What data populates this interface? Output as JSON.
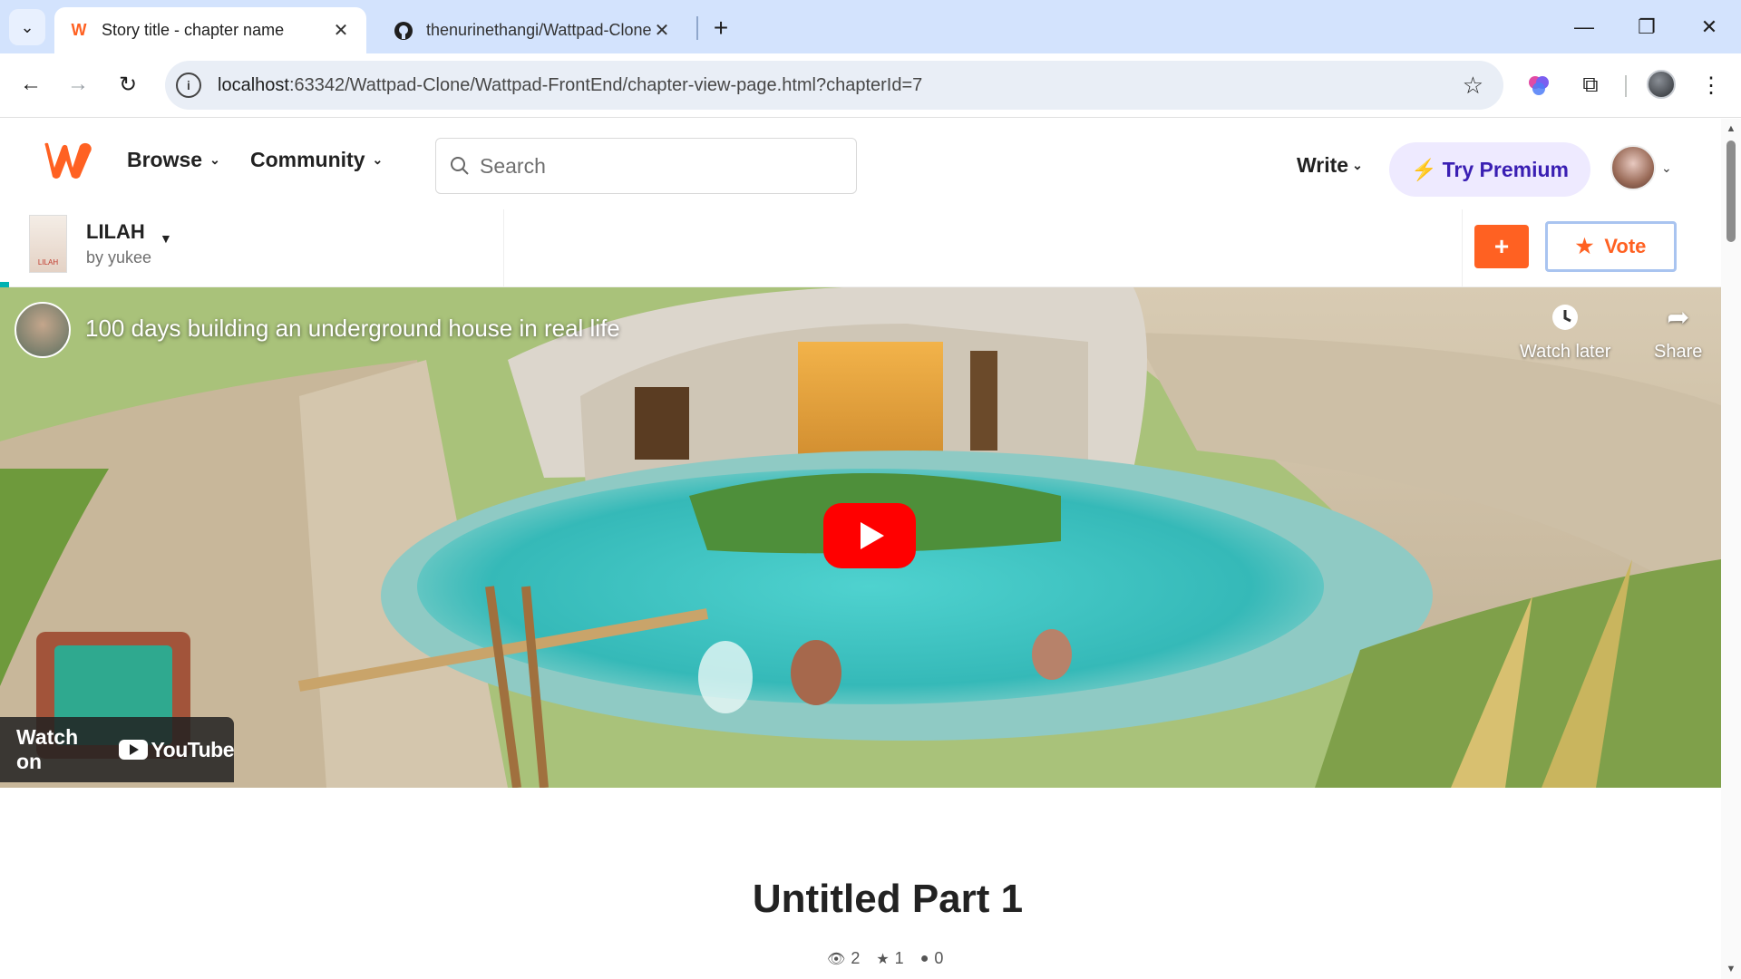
{
  "browser": {
    "tabs": [
      {
        "title": "Story title - chapter name",
        "favicon": "wattpad-w",
        "active": true
      },
      {
        "title": "thenurinethangi/Wattpad-Clone",
        "favicon": "github-icon",
        "active": false
      }
    ],
    "new_tab_label": "+",
    "url_host": "localhost",
    "url_path": ":63342/Wattpad-Clone/Wattpad-FrontEnd/chapter-view-page.html?chapterId=7"
  },
  "header": {
    "nav": [
      {
        "label": "Browse"
      },
      {
        "label": "Community"
      }
    ],
    "search_placeholder": "Search",
    "write_label": "Write",
    "premium_label": "Try Premium"
  },
  "story": {
    "title": "LILAH",
    "author": "by yukee",
    "cover_text": "LILAH",
    "add_label": "+",
    "vote_label": "Vote"
  },
  "video": {
    "title": "100 days building an underground house in real life",
    "watch_later": "Watch later",
    "share": "Share",
    "watch_on": "Watch on",
    "youtube_word": "YouTube"
  },
  "chapter": {
    "title": "Untitled Part 1",
    "reads": "2",
    "votes": "1",
    "comments": "0"
  },
  "colors": {
    "brand_orange": "#ff6122",
    "premium_purple": "#3a1fb3",
    "youtube_red": "#ff0000"
  }
}
